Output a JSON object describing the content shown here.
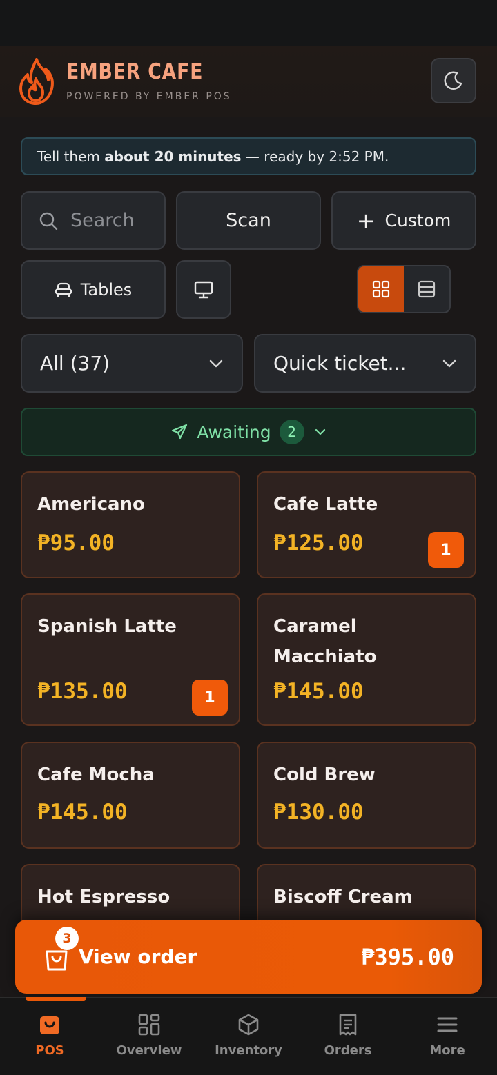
{
  "header": {
    "brand_name": "EMBER CAFE",
    "brand_sub": "POWERED BY EMBER POS"
  },
  "banner": {
    "prefix": "Tell them ",
    "bold": "about 20 minutes",
    "suffix": " — ready by 2:52 PM."
  },
  "toolbar": {
    "search_placeholder": "Search",
    "scan_label": "Scan",
    "custom_label": "Custom",
    "tables_label": "Tables"
  },
  "filters": {
    "category_value": "All (37)",
    "ticket_value": "Quick ticket..."
  },
  "awaiting": {
    "label": "Awaiting",
    "count": "2"
  },
  "products": [
    {
      "name": "Americano",
      "price": "₱95.00",
      "qty": ""
    },
    {
      "name": "Cafe Latte",
      "price": "₱125.00",
      "qty": "1"
    },
    {
      "name": "Spanish Latte",
      "price": "₱135.00",
      "qty": "1"
    },
    {
      "name": "Caramel Macchiato",
      "price": "₱145.00",
      "qty": ""
    },
    {
      "name": "Cafe Mocha",
      "price": "₱145.00",
      "qty": ""
    },
    {
      "name": "Cold Brew",
      "price": "₱130.00",
      "qty": ""
    },
    {
      "name": "Hot Espresso",
      "price": "",
      "qty": ""
    },
    {
      "name": "Biscoff Cream Latte",
      "price": "",
      "qty": ""
    }
  ],
  "order_bar": {
    "count": "3",
    "label": "View order",
    "total": "₱395.00"
  },
  "tabs": [
    {
      "label": "POS",
      "icon": "pos-bag-icon"
    },
    {
      "label": "Overview",
      "icon": "grid-icon"
    },
    {
      "label": "Inventory",
      "icon": "box-icon"
    },
    {
      "label": "Orders",
      "icon": "receipt-icon"
    },
    {
      "label": "More",
      "icon": "menu-icon"
    }
  ],
  "colors": {
    "accent": "#e85808",
    "price": "#f3b325",
    "brand": "#f6a27e",
    "awaiting": "#7fe0a6"
  }
}
